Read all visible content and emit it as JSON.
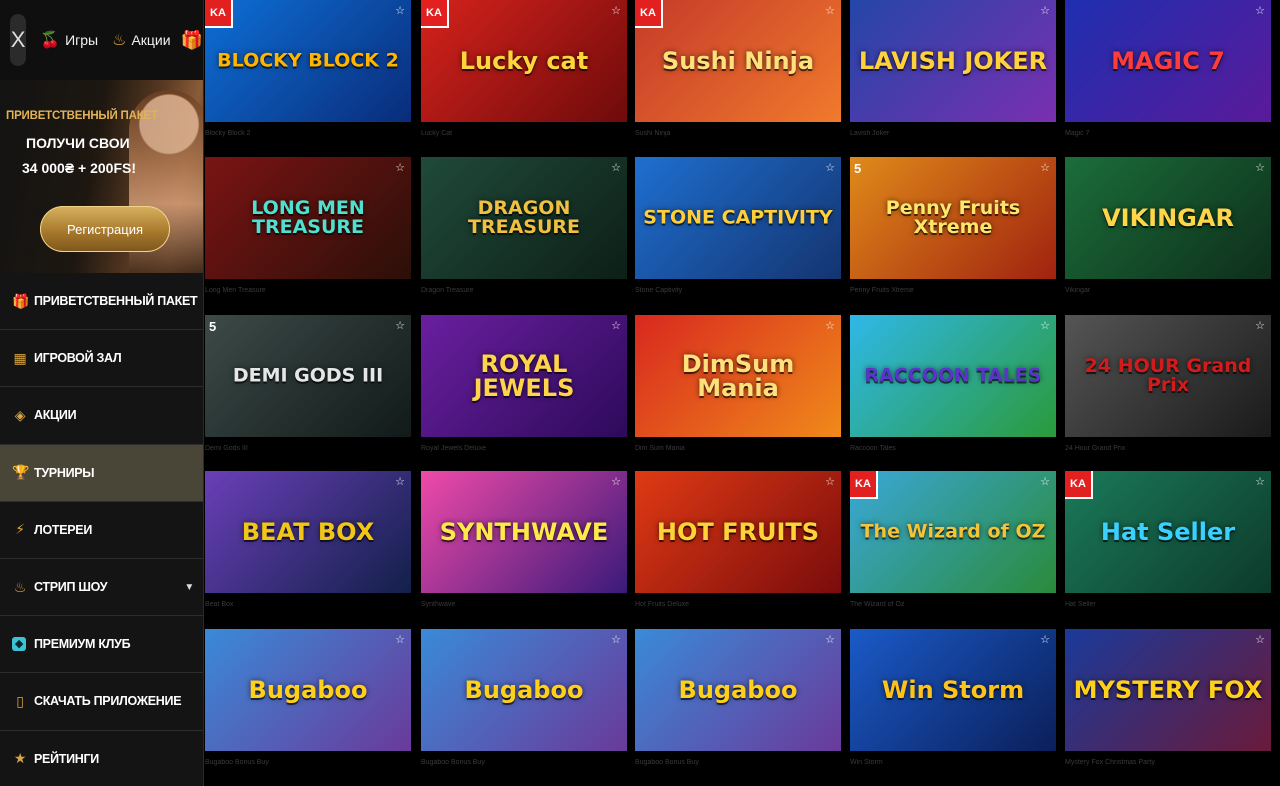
{
  "topbar": {
    "close_label": "X",
    "games_label": "Игры",
    "promo_label": "Акции"
  },
  "promo": {
    "line1": "ПРИВЕТСТВЕННЫЙ ПАКЕТ",
    "line2": "ПОЛУЧИ СВОИ",
    "line3": "34 000₴ + 200FS!",
    "button": "Регистрация"
  },
  "menu": [
    {
      "label": "ПРИВЕТСТВЕННЫЙ ПАКЕТ",
      "icon": "gift-icon"
    },
    {
      "label": "ИГРОВОЙ ЗАЛ",
      "icon": "slot-icon"
    },
    {
      "label": "АКЦИИ",
      "icon": "tag-icon"
    },
    {
      "label": "ТУРНИРЫ",
      "icon": "trophy-icon",
      "active": true
    },
    {
      "label": "ЛОТЕРЕИ",
      "icon": "lottery-icon"
    },
    {
      "label": "СТРИП ШОУ",
      "icon": "strip-icon",
      "caret": true
    },
    {
      "label": "ПРЕМИУМ КЛУБ",
      "icon": "diamond-icon"
    },
    {
      "label": "СКАЧАТЬ ПРИЛОЖЕНИЕ",
      "icon": "phone-icon"
    },
    {
      "label": "РЕЙТИНГИ",
      "icon": "star-icon"
    }
  ],
  "games": [
    {
      "title": "BLOCKY BLOCK 2",
      "caption": "Blocky Block 2",
      "bg": [
        "#0d6fd6",
        "#0a2c7a"
      ],
      "fg": "#ffb400",
      "badge": "ka"
    },
    {
      "title": "Lucky cat",
      "caption": "Lucky Cat",
      "bg": [
        "#d6221c",
        "#6e0b0b"
      ],
      "fg": "#ffd53d",
      "badge": "ka"
    },
    {
      "title": "Sushi Ninja",
      "caption": "Sushi Ninja",
      "bg": [
        "#c63a2a",
        "#f07a2c"
      ],
      "fg": "#ffe07a",
      "badge": "ka"
    },
    {
      "title": "LAVISH JOKER",
      "caption": "Lavish Joker",
      "bg": [
        "#2446a8",
        "#7a2fb0"
      ],
      "fg": "#ffd23c",
      "badge": ""
    },
    {
      "title": "MAGIC 7",
      "caption": "Magic 7",
      "bg": [
        "#1e2fb0",
        "#5a1a9a"
      ],
      "fg": "#ff3c3c",
      "badge": ""
    },
    {
      "title": "LONG MEN TREASURE",
      "caption": "Long Men Treasure",
      "bg": [
        "#7a1414",
        "#2b0f08"
      ],
      "fg": "#4fe0d0",
      "badge": ""
    },
    {
      "title": "DRAGON TREASURE",
      "caption": "Dragon Treasure",
      "bg": [
        "#204a3a",
        "#0d1f17"
      ],
      "fg": "#f0c040",
      "badge": ""
    },
    {
      "title": "STONE CAPTIVITY",
      "caption": "Stone Captivity",
      "bg": [
        "#1e6fd0",
        "#143470"
      ],
      "fg": "#ffcf3a",
      "badge": ""
    },
    {
      "title": "Penny Fruits Xtreme",
      "caption": "Penny Fruits Xtreme",
      "bg": [
        "#e08a1a",
        "#a0220f"
      ],
      "fg": "#ffe56a",
      "badge": "five"
    },
    {
      "title": "VIKINGAR",
      "caption": "Vikingar",
      "bg": [
        "#1b6e3a",
        "#0e2e1b"
      ],
      "fg": "#ffd64a",
      "badge": ""
    },
    {
      "title": "DEMI GODS III",
      "caption": "Demi Gods III",
      "bg": [
        "#3c4a48",
        "#111a19"
      ],
      "fg": "#e6e6e6",
      "badge": "five"
    },
    {
      "title": "ROYAL JEWELS",
      "caption": "Royal Jewels Deluxe",
      "bg": [
        "#6a1fa0",
        "#2d0a5a"
      ],
      "fg": "#ffd34a",
      "badge": ""
    },
    {
      "title": "DimSum Mania",
      "caption": "Dim Sum Mania",
      "bg": [
        "#d8281f",
        "#f08a1a"
      ],
      "fg": "#ffe07a",
      "badge": ""
    },
    {
      "title": "RACCOON TALES",
      "caption": "Raccoon Tales",
      "bg": [
        "#2fb8e8",
        "#2b9a3a"
      ],
      "fg": "#5b34c9",
      "badge": ""
    },
    {
      "title": "24 HOUR Grand Prix",
      "caption": "24 Hour Grand Prix",
      "bg": [
        "#555555",
        "#1a1a1a"
      ],
      "fg": "#d21b1b",
      "badge": ""
    },
    {
      "title": "BEAT BOX",
      "caption": "Beat Box",
      "bg": [
        "#6a3fb8",
        "#12204a"
      ],
      "fg": "#f2c614",
      "badge": ""
    },
    {
      "title": "SYNTHWAVE",
      "caption": "Synthwave",
      "bg": [
        "#f04aa8",
        "#3a1a7a"
      ],
      "fg": "#ffe84a",
      "badge": ""
    },
    {
      "title": "HOT FRUITS",
      "caption": "Hot Fruits Deluxe",
      "bg": [
        "#e03a14",
        "#7a0c0c"
      ],
      "fg": "#ffd23a",
      "badge": ""
    },
    {
      "title": "The Wizard of OZ",
      "caption": "The Wizard of Oz",
      "bg": [
        "#3aa8d8",
        "#2a8a3a"
      ],
      "fg": "#f2c43a",
      "badge": "ka"
    },
    {
      "title": "Hat Seller",
      "caption": "Hat Seller",
      "bg": [
        "#1a7a5a",
        "#0d3a2a"
      ],
      "fg": "#3ad0ff",
      "badge": "ka"
    },
    {
      "title": "Bugaboo",
      "caption": "Bugaboo Bonus Buy",
      "bg": [
        "#3a8ad8",
        "#6a3a9a"
      ],
      "fg": "#ffd01a",
      "badge": ""
    },
    {
      "title": "Bugaboo",
      "caption": "Bugaboo Bonus Buy",
      "bg": [
        "#3a8ad8",
        "#6a3a9a"
      ],
      "fg": "#ffd01a",
      "badge": ""
    },
    {
      "title": "Bugaboo",
      "caption": "Bugaboo Bonus Buy",
      "bg": [
        "#3a8ad8",
        "#6a3a9a"
      ],
      "fg": "#ffd01a",
      "badge": ""
    },
    {
      "title": "Win Storm",
      "caption": "Win Storm",
      "bg": [
        "#1a5ac8",
        "#0b1f5a"
      ],
      "fg": "#ffc21a",
      "badge": ""
    },
    {
      "title": "MYSTERY FOX",
      "caption": "Mystery Fox Christmas Party",
      "bg": [
        "#1a3a9a",
        "#6a1a3a"
      ],
      "fg": "#ffd01a",
      "badge": ""
    }
  ],
  "ui": {
    "fav_glyph": "☆",
    "ka_label": "KA",
    "five_label": "5",
    "caret": "▼"
  },
  "colors": {
    "accent": "#d9a441",
    "active_row": "#4a4637",
    "sidebar_bg": "#141414"
  }
}
